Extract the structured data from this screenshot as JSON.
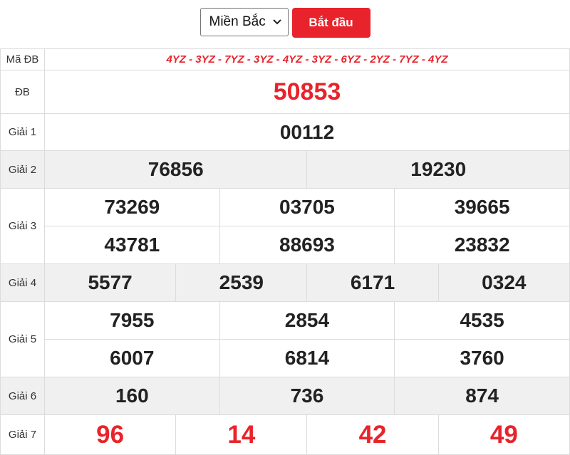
{
  "controls": {
    "region_selected": "Miền Bắc",
    "start_label": "Bắt đầu"
  },
  "labels": {
    "ma_db": "Mã ĐB",
    "db": "ĐB",
    "g1": "Giải 1",
    "g2": "Giải 2",
    "g3": "Giải 3",
    "g4": "Giải 4",
    "g5": "Giải 5",
    "g6": "Giải 6",
    "g7": "Giải 7"
  },
  "results": {
    "ma_db": "4YZ - 3YZ - 7YZ - 3YZ - 4YZ - 3YZ - 6YZ - 2YZ - 7YZ - 4YZ",
    "db": "50853",
    "g1": [
      "00112"
    ],
    "g2": [
      "76856",
      "19230"
    ],
    "g3": [
      "73269",
      "03705",
      "39665",
      "43781",
      "88693",
      "23832"
    ],
    "g4": [
      "5577",
      "2539",
      "6171",
      "0324"
    ],
    "g5": [
      "7955",
      "2854",
      "4535",
      "6007",
      "6814",
      "3760"
    ],
    "g6": [
      "160",
      "736",
      "874"
    ],
    "g7": [
      "96",
      "14",
      "42",
      "49"
    ]
  },
  "colors": {
    "accent_red": "#e8232b",
    "row_shade": "#f0f0f0",
    "border": "#dcdcdc"
  }
}
